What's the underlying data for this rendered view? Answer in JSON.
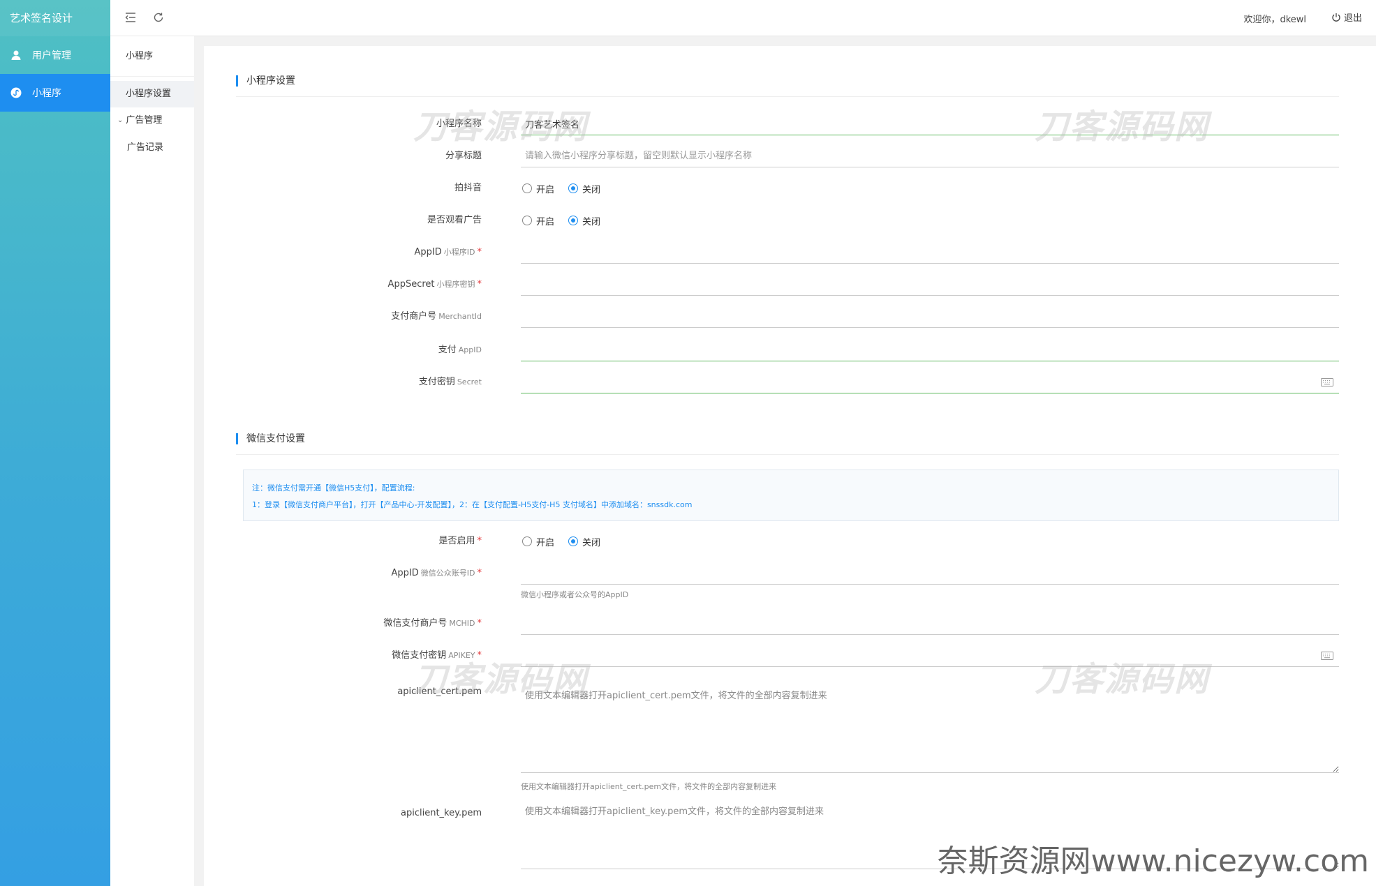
{
  "app": {
    "brand": "艺术签名设计"
  },
  "sidebar": {
    "items": [
      {
        "label": "用户管理",
        "icon": "user-icon"
      },
      {
        "label": "小程序",
        "icon": "mini-program-icon",
        "active": true
      }
    ]
  },
  "header": {
    "welcome": "欢迎你，dkewl",
    "logout": "退出"
  },
  "subnav": {
    "title": "小程序",
    "items": [
      {
        "label": "小程序设置",
        "active": true
      },
      {
        "label": "广告管理",
        "expanded": true
      },
      {
        "label": "广告记录"
      }
    ]
  },
  "sections": {
    "mini": {
      "title": "小程序设置"
    },
    "wxpay": {
      "title": "微信支付设置"
    }
  },
  "form": {
    "name": {
      "label": "小程序名称",
      "value": "刀客艺术签名"
    },
    "share": {
      "label": "分享标题",
      "placeholder": "请输入微信小程序分享标题，留空则默认显示小程序名称"
    },
    "douyin": {
      "label": "拍抖音",
      "on": "开启",
      "off": "关闭",
      "selected": "关闭"
    },
    "ad": {
      "label": "是否观看广告",
      "on": "开启",
      "off": "关闭",
      "selected": "关闭"
    },
    "appid": {
      "label": "AppID",
      "sub": "小程序ID",
      "required": "*"
    },
    "appsecret": {
      "label": "AppSecret",
      "sub": "小程序密钥",
      "required": "*"
    },
    "merchant": {
      "label": "支付商户号",
      "sub": "MerchantId"
    },
    "payappid": {
      "label": "支付",
      "sub": "AppID"
    },
    "paysecret": {
      "label": "支付密钥",
      "sub": "Secret"
    }
  },
  "notice": {
    "line1": "注：微信支付需开通【微信H5支付】，配置流程:",
    "line2": "1：登录【微信支付商户平台】，打开【产品中心-开发配置】，2：在【支付配置-H5支付-H5 支付域名】中添加域名：snssdk.com"
  },
  "wx": {
    "enable": {
      "label": "是否启用",
      "required": "*",
      "on": "开启",
      "off": "关闭",
      "selected": "关闭"
    },
    "appid": {
      "label": "AppID",
      "sub": "微信公众账号ID",
      "required": "*",
      "help": "微信小程序或者公众号的AppID"
    },
    "mchid": {
      "label": "微信支付商户号",
      "sub": "MCHID",
      "required": "*"
    },
    "apikey": {
      "label": "微信支付密钥",
      "sub": "APIKEY",
      "required": "*"
    },
    "cert": {
      "label": "apiclient_cert.pem",
      "placeholder": "使用文本编辑器打开apiclient_cert.pem文件，将文件的全部内容复制进来",
      "help": "使用文本编辑器打开apiclient_cert.pem文件，将文件的全部内容复制进来"
    },
    "key": {
      "label": "apiclient_key.pem",
      "placeholder": "使用文本编辑器打开apiclient_key.pem文件，将文件的全部内容复制进来"
    }
  },
  "watermarks": {
    "text": "刀客源码网",
    "footer": "奈斯资源网www.nicezyw.com"
  },
  "colors": {
    "accent": "#1e8ef0",
    "sidebar_top": "#4fc0c3",
    "sidebar_bottom": "#349fe3",
    "required": "#e4393c",
    "valid": "#5cb85c"
  }
}
